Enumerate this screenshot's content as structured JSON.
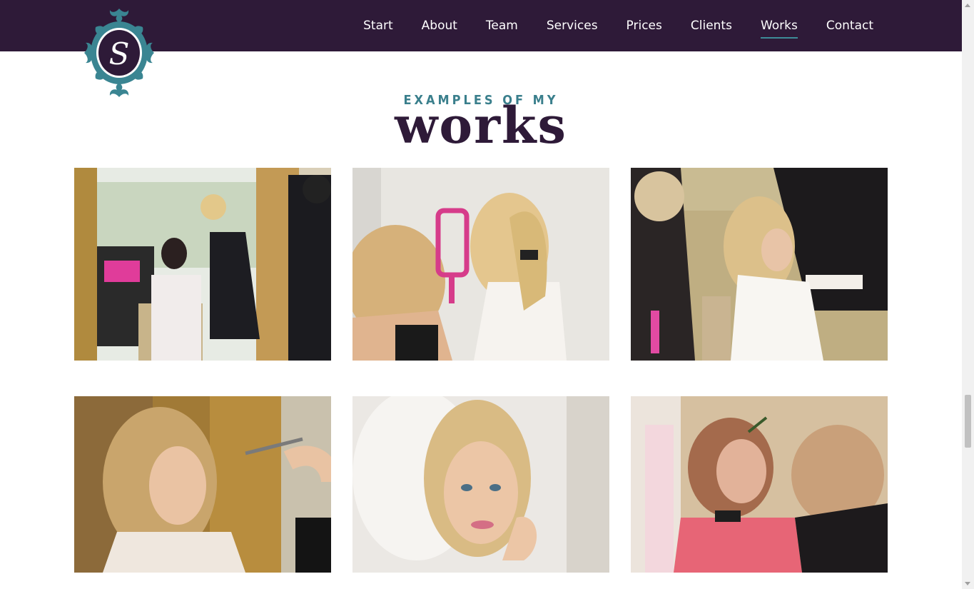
{
  "nav": {
    "items": [
      {
        "label": "Start"
      },
      {
        "label": "About"
      },
      {
        "label": "Team"
      },
      {
        "label": "Services"
      },
      {
        "label": "Prices"
      },
      {
        "label": "Clients"
      },
      {
        "label": "Works",
        "active": true
      },
      {
        "label": "Contact"
      }
    ]
  },
  "logo": {
    "monogram": "S",
    "icon": "ornamental-crest-logo"
  },
  "section": {
    "eyebrow": "EXAMPLES OF MY",
    "title": "works"
  },
  "gallery": {
    "photos": [
      {
        "name": "makeup-session-window-photo"
      },
      {
        "name": "bride-hand-mirror-photo"
      },
      {
        "name": "hair-styling-photo"
      },
      {
        "name": "airbrush-makeup-photo"
      },
      {
        "name": "bride-portrait-photo"
      },
      {
        "name": "eyebrow-makeup-photo"
      }
    ]
  },
  "colors": {
    "navbar_bg": "#2e1a38",
    "accent": "#3d8c98",
    "title": "#2e1a38"
  }
}
